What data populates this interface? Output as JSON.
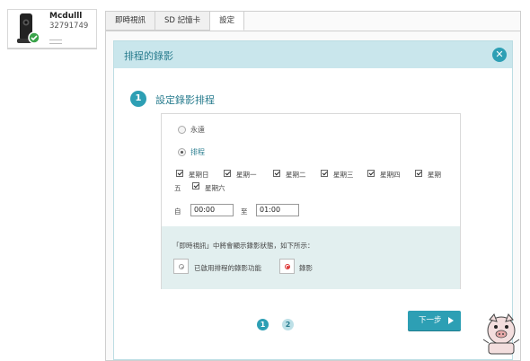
{
  "device": {
    "name": "Mcdulll",
    "id": "32791749"
  },
  "tabs": [
    {
      "label": "即時視訊"
    },
    {
      "label": "SD 記憶卡"
    },
    {
      "label": "設定"
    }
  ],
  "dialog": {
    "title": "排程的錄影",
    "step_number": "1",
    "step_title": "設定錄影排程",
    "options": [
      {
        "label": "永遠",
        "checked": false
      },
      {
        "label": "排程",
        "checked": true
      }
    ],
    "days": {
      "sun": "星期日",
      "mon": "星期一",
      "tue": "星期二",
      "wed": "星期三",
      "thu": "星期四",
      "fri_part1": "星期",
      "fri_part2": "五",
      "sat": "星期六"
    },
    "time": {
      "from_label": "自",
      "from": "00:00",
      "to_label": "至",
      "to": "01:00"
    },
    "info_text": "「即時視訊」中將會顯示錄影狀態，如下所示：",
    "legend": {
      "enabled_label": "已啟用排程的錄影功能",
      "recording_label": "錄影"
    },
    "pagination": {
      "page1": "1",
      "page2": "2"
    },
    "next_button": "下一步"
  },
  "colors": {
    "accent": "#2d9fb4",
    "header": "#c9e6ec",
    "info_bg": "#e2efef"
  }
}
